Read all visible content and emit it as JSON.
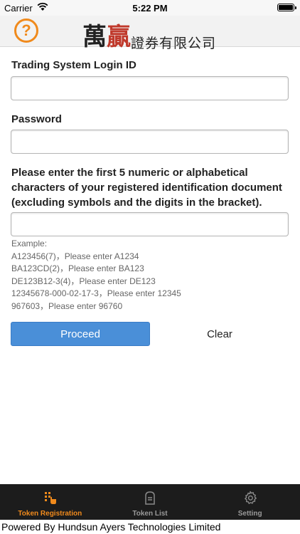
{
  "status_bar": {
    "carrier": "Carrier",
    "time": "5:22 PM"
  },
  "header": {
    "help_symbol": "?",
    "logo_big_1": "萬",
    "logo_big_2": "贏",
    "logo_small": "證券有限公司"
  },
  "form": {
    "login_label": "Trading System Login ID",
    "login_value": "",
    "password_label": "Password",
    "password_value": "",
    "id_label": "Please enter the first 5 numeric or alphabetical characters of your registered identification document (excluding symbols and the digits in the bracket).",
    "id_value": "",
    "examples": [
      "Example:",
      "A123456(7)，Please enter A1234",
      "BA123CD(2)，Please enter BA123",
      "DE123B12-3(4)，Please enter DE123",
      "12345678-000-02-17-3，Please enter 12345",
      "967603，Please enter 96760"
    ],
    "proceed_label": "Proceed",
    "clear_label": "Clear"
  },
  "tabs": [
    {
      "label": "Token Registration",
      "icon": "grid-hand-icon",
      "active": true
    },
    {
      "label": "Token List",
      "icon": "token-list-icon",
      "active": false
    },
    {
      "label": "Setting",
      "icon": "gear-icon",
      "active": false
    }
  ],
  "footer": {
    "text": "Powered By Hundsun Ayers Technologies Limited"
  },
  "colors": {
    "accent": "#f08a1c",
    "primary_button": "#4a8fd8",
    "tab_bar": "#1c1c1c"
  }
}
